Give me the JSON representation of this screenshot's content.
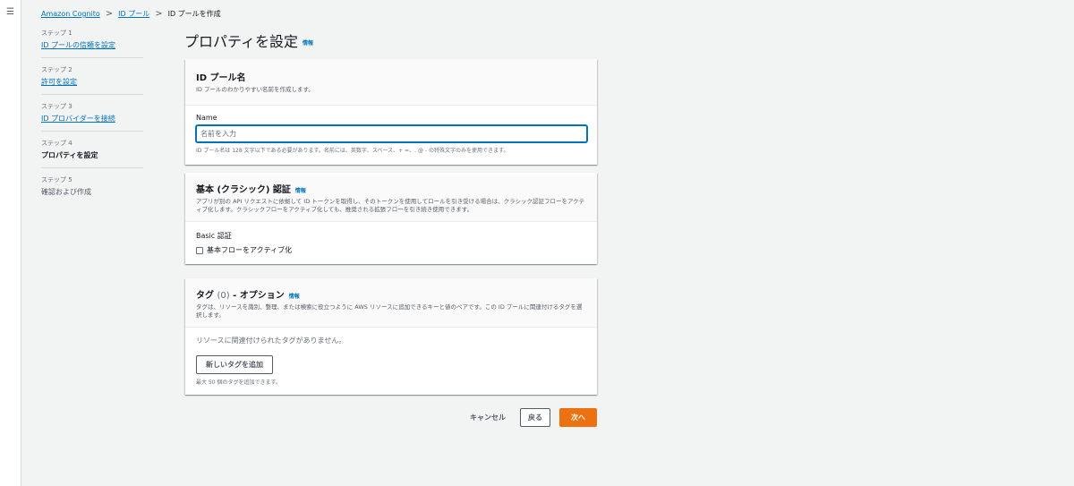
{
  "nav": {
    "menu_icon": "menu-icon"
  },
  "breadcrumb": {
    "items": [
      {
        "label": "Amazon Cognito"
      },
      {
        "label": "ID プール"
      },
      {
        "label": "ID プールを作成"
      }
    ],
    "separator": ">"
  },
  "steps": [
    {
      "number": "ステップ 1",
      "label": "ID プールの信頼を設定",
      "state": "link"
    },
    {
      "number": "ステップ 2",
      "label": "許可を設定",
      "state": "link"
    },
    {
      "number": "ステップ 3",
      "label": "ID プロバイダーを接続",
      "state": "link"
    },
    {
      "number": "ステップ 4",
      "label": "プロパティを設定",
      "state": "active"
    },
    {
      "number": "ステップ 5",
      "label": "確認および作成",
      "state": "disabled"
    }
  ],
  "page": {
    "title": "プロパティを設定",
    "info": "情報"
  },
  "pool_name": {
    "title": "ID プール名",
    "description": "ID プールのわかりやすい名前を作成します。",
    "field_label": "Name",
    "placeholder": "名前を入力",
    "value": "",
    "hint": "ID プール名は 128 文字以下である必要があります。名前には、英数字、スペース、+ =、. @ - の特殊文字のみを使用できます。"
  },
  "basic_auth": {
    "title": "基本 (クラシック) 認証",
    "info": "情報",
    "description": "アプリが別の API リクエストに依拠して ID トークンを取得し、そのトークンを使用してロールを引き受ける場合は、クラシック認証フローをアクティブ化します。クラシックフローをアクティブ化しても、推奨される拡張フローを引き続き使用できます。",
    "field_label": "Basic 認証",
    "checkbox_label": "基本フローをアクティブ化",
    "checked": false
  },
  "tags": {
    "title": "タグ",
    "count": "(0)",
    "suffix": "- オプション",
    "info": "情報",
    "description": "タグは、リソースを識別、整理、または検索に役立つように AWS リソースに追加できるキーと値のペアです。この ID プールに関連付けるタグを選択します。",
    "empty": "リソースに関連付けられたタグがありません。",
    "add_button": "新しいタグを追加",
    "limit": "最大 50 個のタグを追加できます。"
  },
  "footer": {
    "cancel": "キャンセル",
    "back": "戻る",
    "next": "次へ"
  },
  "colors": {
    "link": "#0073bb",
    "primary": "#ec7211",
    "background": "#f2f3f3"
  }
}
